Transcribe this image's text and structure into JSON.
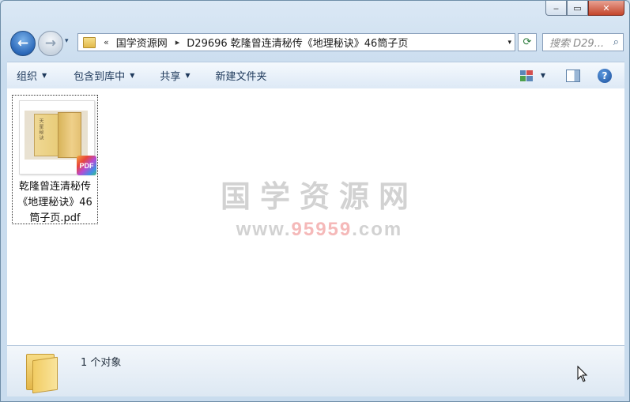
{
  "window": {
    "minimize_label": "‒",
    "maximize_label": "▭",
    "close_label": "✕"
  },
  "nav": {
    "back_label": "←",
    "forward_label": "→",
    "history_label": "▾"
  },
  "address": {
    "overflow_label": "«",
    "crumb_root": "国学资源网",
    "separator": "▸",
    "crumb_current": "D29696 乾隆曾连清秘传《地理秘诀》46筒子页",
    "dropdown_label": "▾",
    "refresh_label": "⟳"
  },
  "search": {
    "placeholder": "搜索 D29...",
    "icon": "⌕"
  },
  "toolbar": {
    "organize": "组织",
    "include_library": "包含到库中",
    "share": "共享",
    "new_folder": "新建文件夹",
    "dropdown_arrow": "▼",
    "help_label": "?"
  },
  "file": {
    "name_line1": "乾隆曾连清秘传",
    "name_line2": "《地理秘诀》46",
    "name_line3": "筒子页.pdf",
    "badge": "PDF",
    "thumb_text": "天星秘诀"
  },
  "watermark": {
    "main": "国学资源网",
    "url_pre": "www.",
    "url_hl": "95959",
    "url_post": ".com"
  },
  "details": {
    "count_text": "1 个对象"
  }
}
